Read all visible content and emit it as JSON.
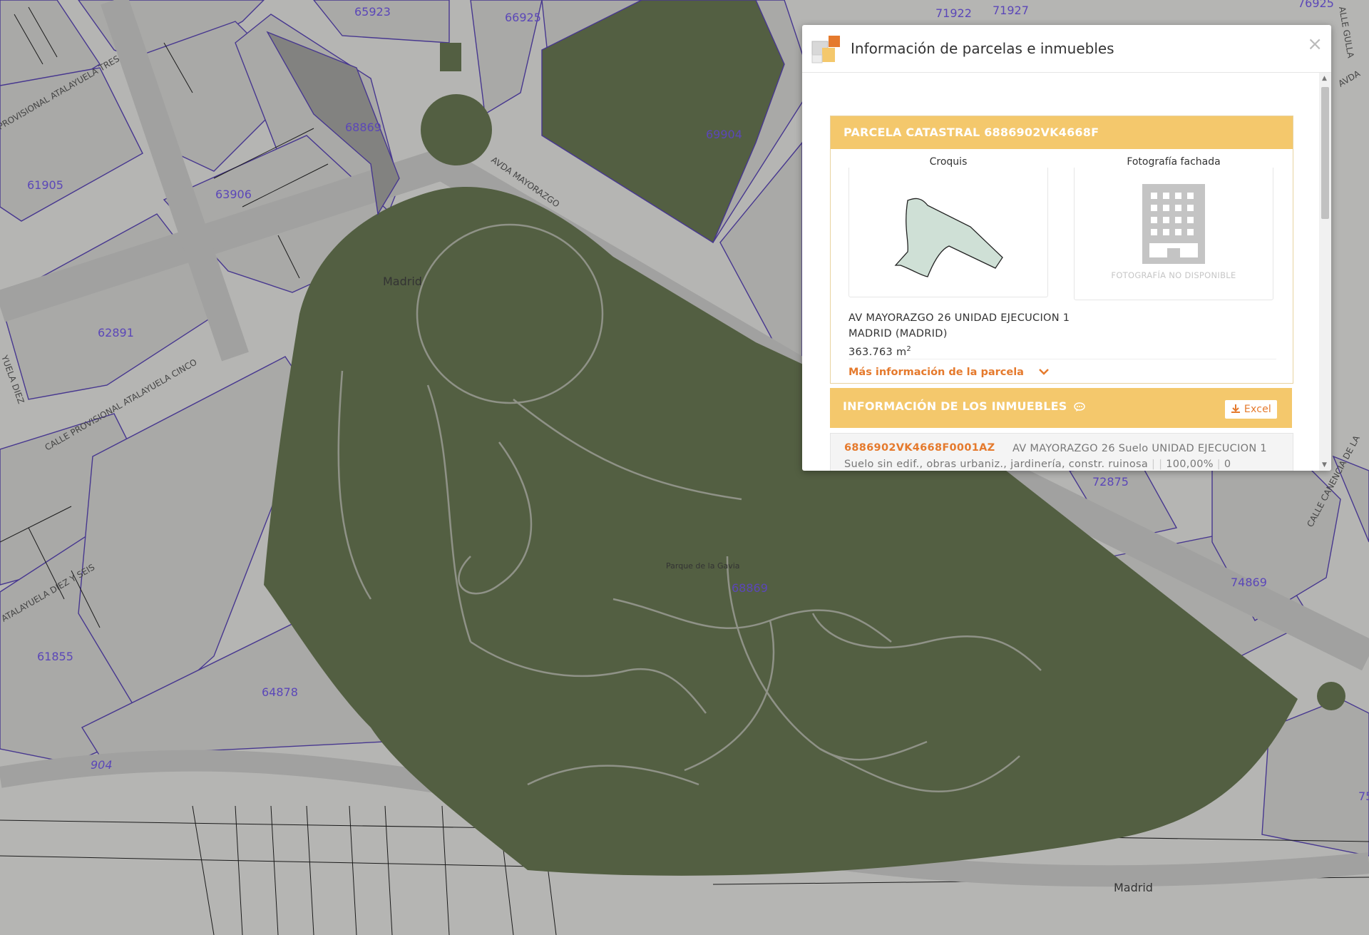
{
  "map": {
    "parcel_labels": [
      "65923",
      "66925",
      "71922",
      "71927",
      "76925",
      "68869",
      "69904",
      "61905",
      "63906",
      "62891",
      "61855",
      "64878",
      "72875",
      "74869",
      "68869",
      "75"
    ],
    "street_labels": [
      "AVDA MAYORAZGO",
      "CALLE PROVISIONAL ATALAYUELA CINCO",
      "PROVISIONAL ATALAYUELA TRES",
      "ATALAYUELA DIEZ Y SEIS",
      "YUELA DIEZ",
      "CALLE CANENCIA DE LA",
      "AVDA",
      "ALLE GULLA"
    ],
    "place_labels": [
      "Madrid",
      "Madrid",
      "Parque de la Gavia"
    ],
    "road_number": "904",
    "colors": {
      "park": "#6b7a55",
      "parcel_line": "#5b47b8",
      "base": "#e8e8e6"
    }
  },
  "dialog": {
    "title": "Información de parcelas e inmuebles",
    "close_icon": "×",
    "parcel": {
      "header": "PARCELA CATASTRAL 6886902VK4668F",
      "sketch_title": "Croquis",
      "photo_title": "Fotografía fachada",
      "photo_unavailable": "FOTOGRAFÍA NO DISPONIBLE",
      "address_line1": "AV MAYORAZGO 26 UNIDAD EJECUCION 1",
      "address_line2": "MADRID (MADRID)",
      "area_value": "363.763 m",
      "area_unit_sup": "2",
      "more_info": "Más información de la parcela"
    },
    "inmuebles": {
      "header": "INFORMACIÓN DE LOS INMUEBLES",
      "excel_label": "Excel",
      "rows": [
        {
          "ref": "6886902VK4668F0001AZ",
          "address": "AV MAYORAZGO 26 Suelo UNIDAD EJECUCION 1",
          "use": "Suelo sin edif., obras urbaniz., jardinería, constr. ruinosa",
          "share": "100,00%",
          "count": "0"
        }
      ]
    },
    "colors": {
      "accent": "#f4c86c",
      "link": "#e57a2d"
    }
  }
}
